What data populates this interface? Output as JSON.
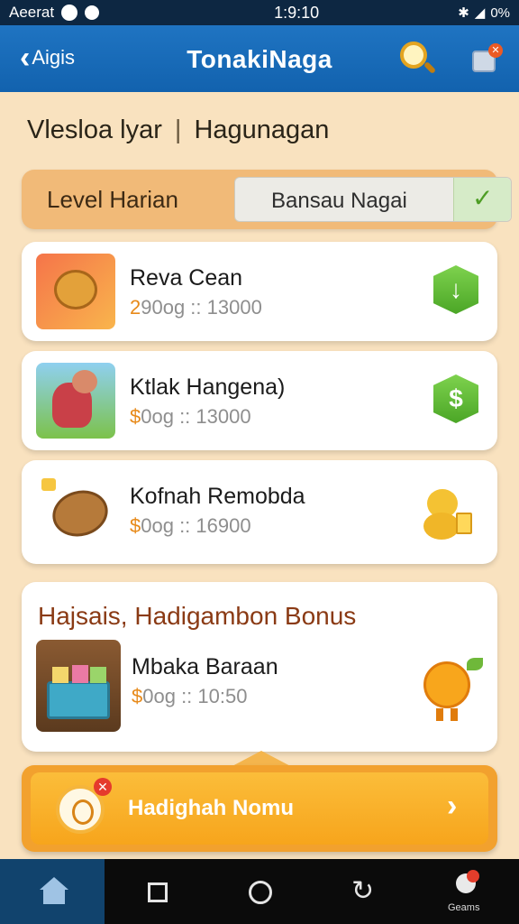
{
  "status": {
    "carrier": "Aeerat",
    "time": "1:9:10",
    "battery": "0%"
  },
  "header": {
    "back_label": "Aigis",
    "title": "TonakiNaga",
    "search_icon": "search-icon",
    "notification_icon": "notification-icon"
  },
  "breadcrumb": {
    "first": "Vlesloa lyar",
    "separator": "|",
    "second": "Hagunagan"
  },
  "level_bar": {
    "label": "Level Harian",
    "select_value": "Bansau Nagai"
  },
  "items": [
    {
      "name": "Reva Cean",
      "price_currency": "2",
      "price_rest": "90og :: 13000",
      "action_icon": "download-icon",
      "action_glyph": "↓"
    },
    {
      "name": "Ktlak Hangena)",
      "price_currency": "$",
      "price_rest": "0og :: 13000",
      "action_icon": "dollar-icon",
      "action_glyph": "$"
    },
    {
      "name": "Kofnah Remobda",
      "price_currency": "$",
      "price_rest": "0og :: 16900",
      "action_icon": "chick-icon"
    }
  ],
  "bonus": {
    "title": "Hajsais, Hadigambon Bonus",
    "item_name": "Mbaka Baraan",
    "price_currency": "$",
    "price_rest": "0og :: 10:50"
  },
  "banner": {
    "label": "Hadighah Nomu"
  },
  "navbar": {
    "game_label": "Geams"
  },
  "colors": {
    "header": "#1f74c2",
    "background": "#f9e2bf",
    "accent": "#f2a12e",
    "action_green": "#5bb52f"
  }
}
